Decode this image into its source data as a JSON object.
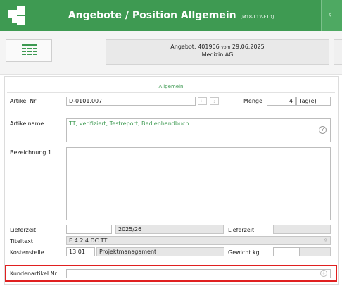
{
  "header": {
    "title": "Angebote / Position Allgemein",
    "code": "[M18-L12-F10]",
    "back_glyph": "‹",
    "accent": "#3e9a52"
  },
  "topbar": {
    "offer_prefix": "Angebot:",
    "offer_number": "401906",
    "offer_vom": "vom",
    "offer_date": "29.06.2025",
    "customer": "Medizin AG"
  },
  "section": {
    "title": "Allgemein"
  },
  "form": {
    "artikel_nr_label": "Artikel Nr",
    "artikel_nr": "D-0101.007",
    "menge_label": "Menge",
    "menge_value": "4",
    "menge_unit": "Tag(e)",
    "artikelname_label": "Artikelname",
    "artikelname": "TT, verifiziert, Testreport, Bedienhandbuch",
    "bezeichnung_label": "Bezeichnung 1",
    "bezeichnung": "",
    "lieferzeit_label": "Lieferzeit",
    "lieferzeit_value": "",
    "lieferzeit_period": "2025/26",
    "lieferzeit2_label": "Lieferzeit",
    "lieferzeit2_value": "",
    "titeltext_label": "Titeltext",
    "titeltext": "E 4.2.4 DC TT",
    "kostenstelle_label": "Kostenstelle",
    "kostenstelle_code": "13.01",
    "kostenstelle_name": "Projektmanagament",
    "gewicht_label": "Gewicht kg",
    "gewicht_value": "",
    "gewicht_unit": "",
    "kundenartikel_label": "Kundenartikel Nr.",
    "kundenartikel_value": ""
  },
  "icons": {
    "back_arrow": "←",
    "help": "?",
    "add": "+",
    "share": "⇪"
  }
}
